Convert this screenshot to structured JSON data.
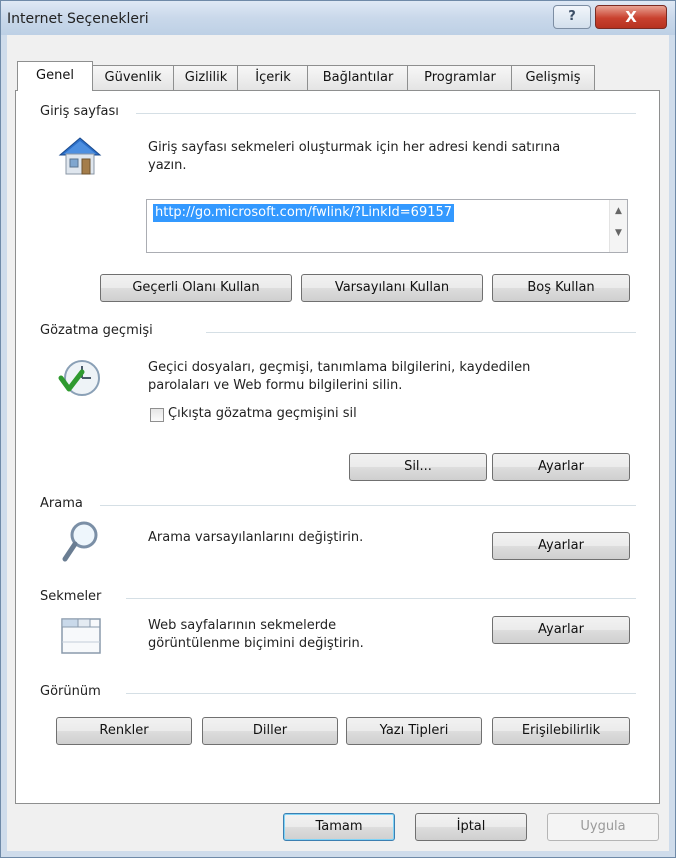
{
  "window": {
    "title": "Internet Seçenekleri",
    "help_glyph": "?",
    "close_glyph": "X"
  },
  "tabs": [
    {
      "label": "Genel"
    },
    {
      "label": "Güvenlik"
    },
    {
      "label": "Gizlilik"
    },
    {
      "label": "İçerik"
    },
    {
      "label": "Bağlantılar"
    },
    {
      "label": "Programlar"
    },
    {
      "label": "Gelişmiş"
    }
  ],
  "home": {
    "heading": "Giriş sayfası",
    "desc_line1": "Giriş sayfası sekmeleri oluşturmak için her adresi kendi satırına",
    "desc_line2": "yazın.",
    "url": "http://go.microsoft.com/fwlink/?LinkId=69157",
    "btn_current": "Geçerli Olanı Kullan",
    "btn_default": "Varsayılanı Kullan",
    "btn_blank": "Boş Kullan",
    "icon": "home-icon"
  },
  "history": {
    "heading": "Gözatma geçmişi",
    "desc_line1": "Geçici dosyaları, geçmişi, tanımlama bilgilerini, kaydedilen",
    "desc_line2": "parolaları ve Web formu bilgilerini silin.",
    "checkbox_label": "Çıkışta gözatma geçmişini sil",
    "checked": false,
    "btn_delete": "Sil...",
    "btn_settings": "Ayarlar",
    "icon": "history-clock-icon"
  },
  "search": {
    "heading": "Arama",
    "desc": "Arama varsayılanlarını değiştirin.",
    "btn_settings": "Ayarlar",
    "icon": "magnifier-icon"
  },
  "tabs_section": {
    "heading": "Sekmeler",
    "desc_line1": "Web sayfalarının sekmelerde",
    "desc_line2": "görüntülenme biçimini değiştirin.",
    "btn_settings": "Ayarlar",
    "icon": "tabs-window-icon"
  },
  "appearance": {
    "heading": "Görünüm",
    "btn_colors": "Renkler",
    "btn_languages": "Diller",
    "btn_fonts": "Yazı Tipleri",
    "btn_accessibility": "Erişilebilirlik"
  },
  "footer": {
    "ok": "Tamam",
    "cancel": "İptal",
    "apply": "Uygula"
  }
}
